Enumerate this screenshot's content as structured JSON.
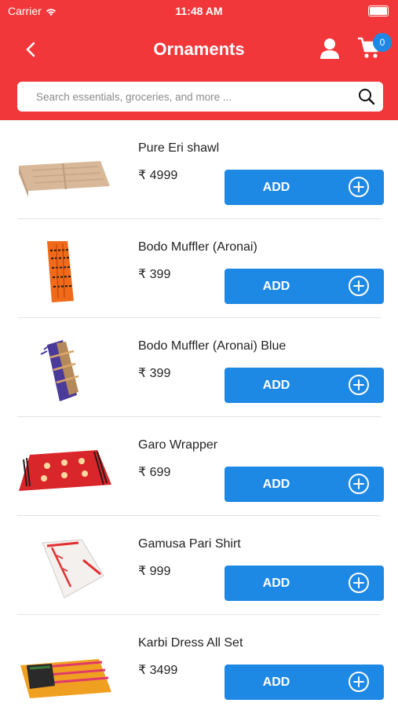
{
  "status_bar": {
    "carrier": "Carrier",
    "time": "11:48 AM"
  },
  "header": {
    "title": "Ornaments",
    "cart_count": "0",
    "colors": {
      "bar": "#f2373a",
      "badge": "#1e88e5"
    }
  },
  "search": {
    "placeholder": "Search essentials, groceries, and more ..."
  },
  "currency": "₹",
  "add_label": "ADD",
  "products": [
    {
      "name": "Pure Eri shawl",
      "price": "4999"
    },
    {
      "name": "Bodo Muffler (Aronai)",
      "price": "399"
    },
    {
      "name": "Bodo Muffler (Aronai) Blue",
      "price": "399"
    },
    {
      "name": "Garo Wrapper",
      "price": "699"
    },
    {
      "name": "Gamusa Pari Shirt",
      "price": "999"
    },
    {
      "name": "Karbi Dress All Set",
      "price": "3499"
    }
  ]
}
